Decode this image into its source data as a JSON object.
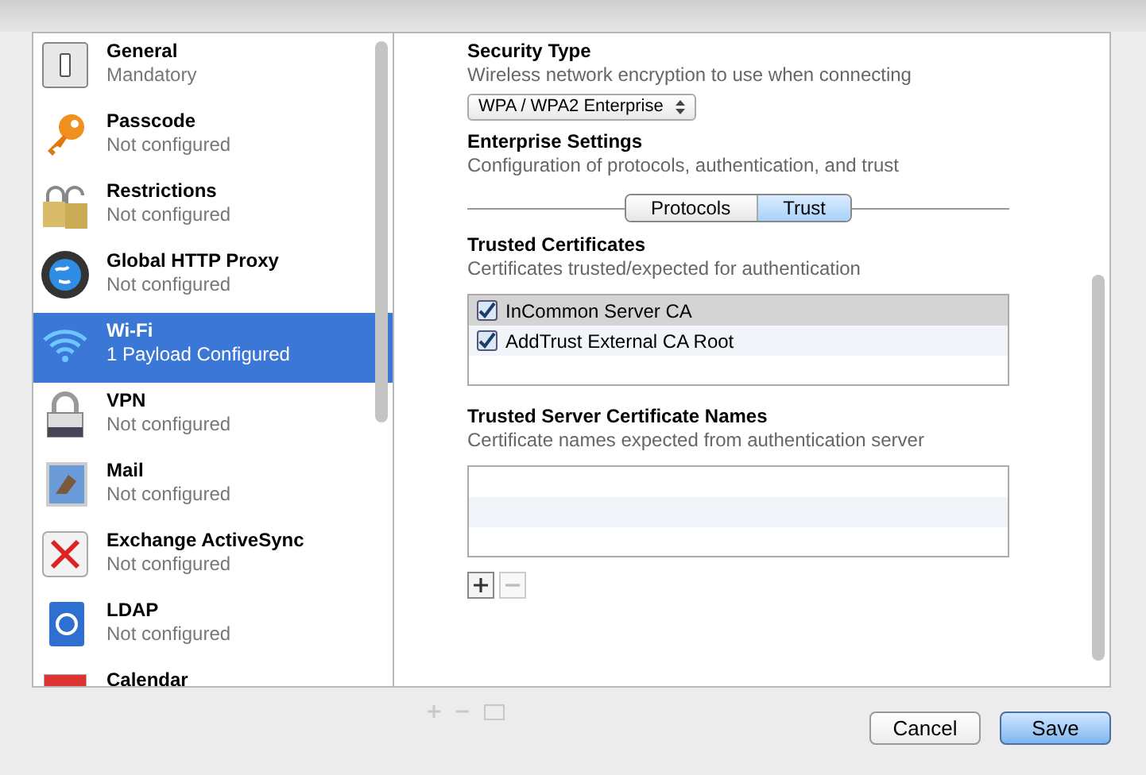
{
  "sidebar": {
    "items": [
      {
        "kind": "general",
        "title": "General",
        "subtitle": "Mandatory",
        "selected": false
      },
      {
        "kind": "passcode",
        "title": "Passcode",
        "subtitle": "Not configured",
        "selected": false
      },
      {
        "kind": "restrictions",
        "title": "Restrictions",
        "subtitle": "Not configured",
        "selected": false
      },
      {
        "kind": "proxy",
        "title": "Global HTTP Proxy",
        "subtitle": "Not configured",
        "selected": false
      },
      {
        "kind": "wifi",
        "title": "Wi-Fi",
        "subtitle": "1 Payload Configured",
        "selected": true
      },
      {
        "kind": "vpn",
        "title": "VPN",
        "subtitle": "Not configured",
        "selected": false
      },
      {
        "kind": "mail",
        "title": "Mail",
        "subtitle": "Not configured",
        "selected": false
      },
      {
        "kind": "exchange",
        "title": "Exchange ActiveSync",
        "subtitle": "Not configured",
        "selected": false
      },
      {
        "kind": "ldap",
        "title": "LDAP",
        "subtitle": "Not configured",
        "selected": false
      },
      {
        "kind": "calendar",
        "title": "Calendar",
        "selected": false
      }
    ]
  },
  "security_type": {
    "title": "Security Type",
    "description": "Wireless network encryption to use when connecting",
    "value": "WPA / WPA2 Enterprise"
  },
  "enterprise_settings": {
    "title": "Enterprise Settings",
    "description": "Configuration of protocols, authentication, and trust",
    "tabs": [
      {
        "label": "Protocols",
        "selected": false
      },
      {
        "label": "Trust",
        "selected": true
      }
    ]
  },
  "trusted_certificates": {
    "title": "Trusted Certificates",
    "description": "Certificates trusted/expected for authentication",
    "rows": [
      {
        "name": "InCommon Server CA",
        "checked": true,
        "selected": true
      },
      {
        "name": "AddTrust External CA Root",
        "checked": true,
        "selected": false
      }
    ]
  },
  "trusted_server_names": {
    "title": "Trusted Server Certificate Names",
    "description": "Certificate names expected from authentication server",
    "remove_disabled": true
  },
  "buttons": [
    {
      "label": "Cancel",
      "default": false
    },
    {
      "label": "Save",
      "default": true
    }
  ]
}
